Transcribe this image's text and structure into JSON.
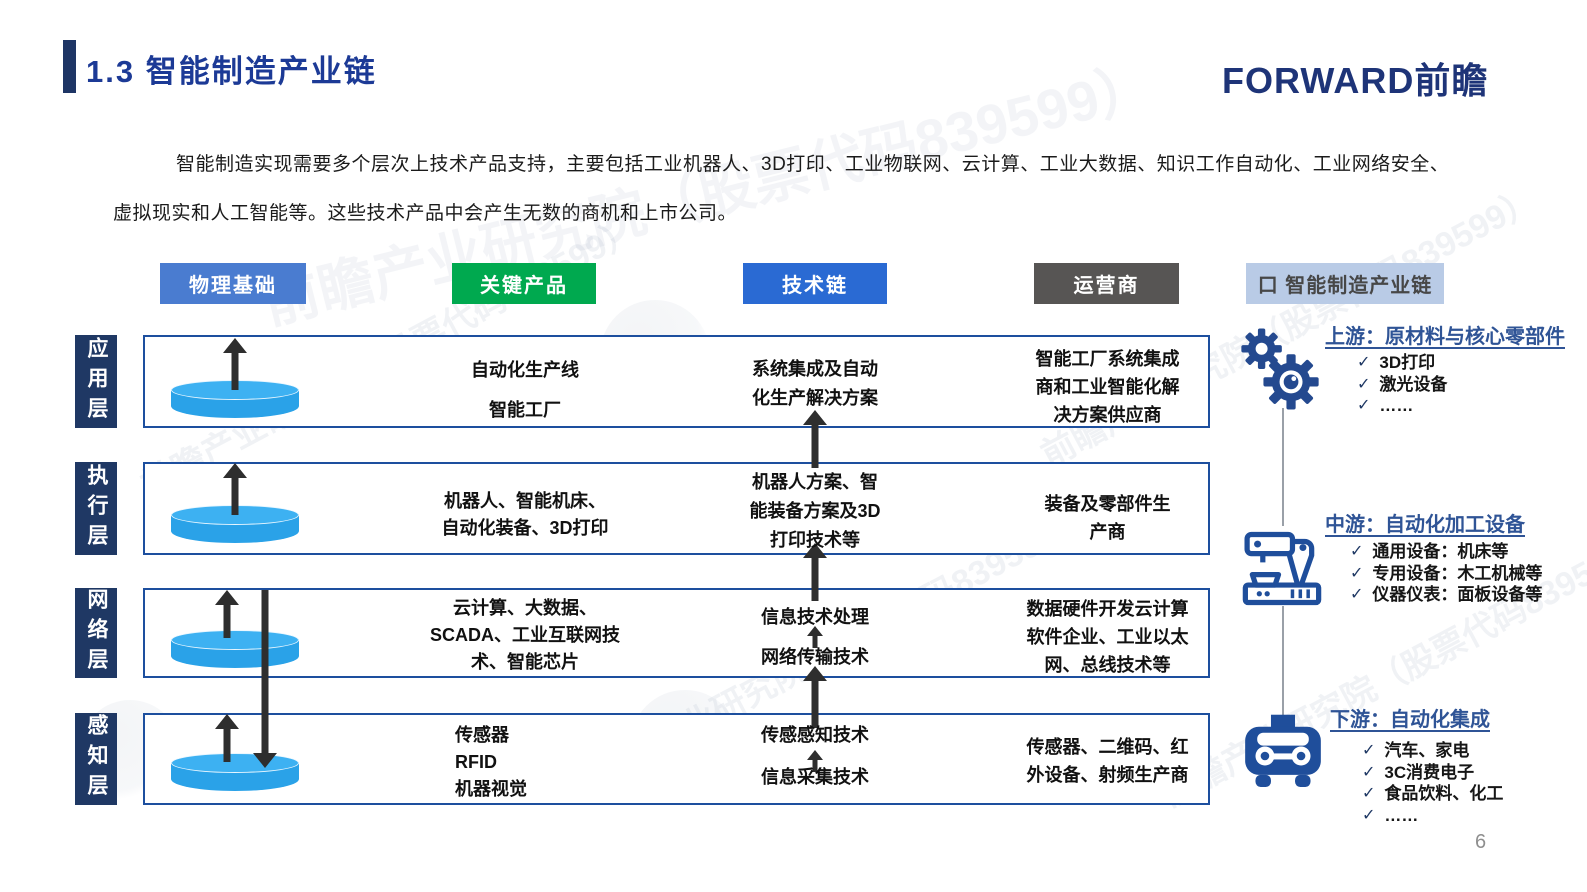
{
  "slide": {
    "title": "1.3 智能制造产业链",
    "logo_text": "FORWARD前瞻",
    "page_number": "6",
    "intro": "智能制造实现需要多个层次上技术产品支持，主要包括工业机器人、3D打印、工业物联网、云计算、工业大数据、知识工作自动化、工业网络安全、虚拟现实和人工智能等。这些技术产品中会产生无数的商机和上市公司。",
    "watermark": "前瞻产业研究院（股票代码839599）"
  },
  "column_headers": [
    {
      "label": "物理基础",
      "color": "#4a7cd0"
    },
    {
      "label": "关键产品",
      "color": "#00a94f"
    },
    {
      "label": "技术链",
      "color": "#2a6ad3"
    },
    {
      "label": "运营商",
      "color": "#575554"
    }
  ],
  "layers": [
    {
      "name": "应用层",
      "key_products": "自动化生产线\n智能工厂",
      "tech_chain": "系统集成及自动\n化生产解决方案",
      "operators": "智能工厂系统集成\n商和工业智能化解\n决方案供应商"
    },
    {
      "name": "执行层",
      "key_products": "机器人、智能机床、\n自动化装备、3D打印",
      "tech_chain": "机器人方案、智\n能装备方案及3D\n打印技术等",
      "operators": "装备及零部件生\n产商"
    },
    {
      "name": "网络层",
      "key_products": "云计算、大数据、\nSCADA、工业互联网技\n术、智能芯片",
      "tech_chain_top": "信息技术处理",
      "tech_chain_bottom": "网络传输技术",
      "operators": "数据硬件开发云计算\n软件企业、工业以太\n网、总线技术等"
    },
    {
      "name": "感知层",
      "key_products": "传感器\nRFID\n机器视觉",
      "tech_chain_top": "传感感知技术",
      "tech_chain_bottom": "信息采集技术",
      "operators": "传感器、二维码、红\n外设备、射频生产商"
    }
  ],
  "industry_chain": {
    "header": "口 智能制造产业链",
    "header_bg": "#b9cbe6",
    "check_icon": "✓",
    "sections": [
      {
        "title": "上游：原材料与核心零部件",
        "icon": "gears-icon",
        "items": [
          "3D打印",
          "激光设备",
          "……"
        ]
      },
      {
        "title": "中游：自动化加工设备",
        "icon": "machine-icon",
        "items": [
          "通用设备：机床等",
          "专用设备：木工机械等",
          "仪器仪表：面板设备等"
        ]
      },
      {
        "title": "下游：自动化集成",
        "icon": "car-icon",
        "items": [
          "汽车、家电",
          "3C消费电子",
          "食品饮料、化工",
          "……"
        ]
      }
    ]
  },
  "colors": {
    "title_blue": "#1c3a96",
    "accent_navy": "#1e3565",
    "layer_label_navy": "#1f3864",
    "box_border_blue": "#1d4f9e",
    "disk_blue": "#2aa2e8",
    "icon_navy": "#1f4e9b",
    "section_title_blue": "#2f5496"
  }
}
